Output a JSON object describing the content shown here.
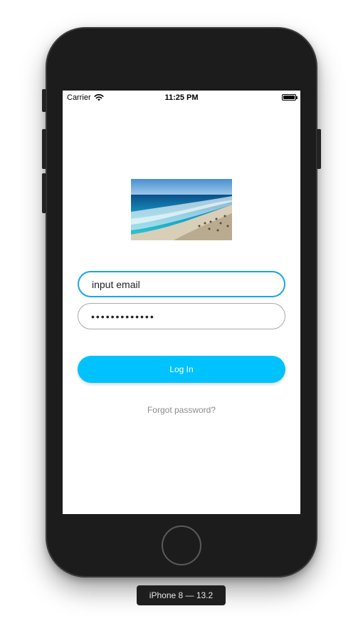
{
  "status_bar": {
    "carrier": "Carrier",
    "time": "11:25 PM"
  },
  "login": {
    "email_value": "input email",
    "password_value": "•••••••••••••",
    "login_label": "Log In",
    "forgot_label": "Forgot password?"
  },
  "device": {
    "label": "iPhone 8 — 13.2"
  },
  "colors": {
    "accent": "#00c2ff",
    "focus_border": "#1aa6e6",
    "link_gray": "#8c8c8c"
  },
  "icons": [
    "wifi-icon",
    "battery-icon",
    "home-button-icon"
  ]
}
